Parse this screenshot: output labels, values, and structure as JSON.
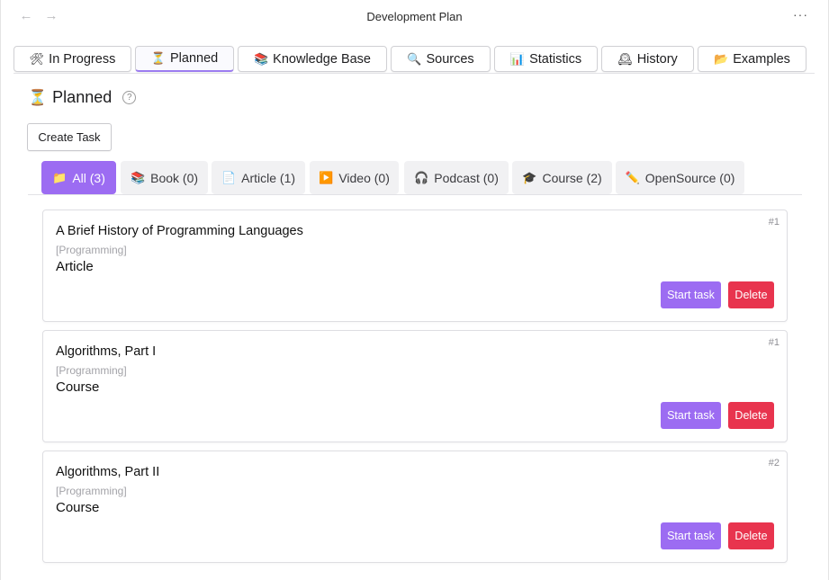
{
  "window": {
    "title": "Development Plan",
    "back_label": "←",
    "forward_label": "→",
    "more_label": "···"
  },
  "tabs": [
    {
      "icon": "🛠",
      "label": "In Progress"
    },
    {
      "icon": "⏳",
      "label": "Planned"
    },
    {
      "icon": "📚",
      "label": "Knowledge Base"
    },
    {
      "icon": "🔍",
      "label": "Sources"
    },
    {
      "icon": "📊",
      "label": "Statistics"
    },
    {
      "icon": "🕰",
      "label": "History"
    },
    {
      "icon": "📂",
      "label": "Examples"
    }
  ],
  "page": {
    "icon": "⏳",
    "heading": "Planned",
    "help": "?",
    "create_label": "Create Task"
  },
  "filters": [
    {
      "icon": "📁",
      "label": "All (3)"
    },
    {
      "icon": "📚",
      "label": "Book (0)"
    },
    {
      "icon": "📄",
      "label": "Article (1)"
    },
    {
      "icon": "▶️",
      "label": "Video (0)"
    },
    {
      "icon": "🎧",
      "label": "Podcast (0)"
    },
    {
      "icon": "🎓",
      "label": "Course (2)"
    },
    {
      "icon": "✏️",
      "label": "OpenSource (0)"
    }
  ],
  "tasks": [
    {
      "number": "#1",
      "title": "A Brief History of Programming Languages",
      "tag": "[Programming]",
      "type": "Article",
      "start_label": "Start task",
      "delete_label": "Delete"
    },
    {
      "number": "#1",
      "title": "Algorithms, Part I",
      "tag": "[Programming]",
      "type": "Course",
      "start_label": "Start task",
      "delete_label": "Delete"
    },
    {
      "number": "#2",
      "title": "Algorithms, Part II",
      "tag": "[Programming]",
      "type": "Course",
      "start_label": "Start task",
      "delete_label": "Delete"
    }
  ],
  "colors": {
    "accent": "#9c6cf2",
    "danger": "#e8344e",
    "active_tab_underline": "#9c7cf0"
  }
}
